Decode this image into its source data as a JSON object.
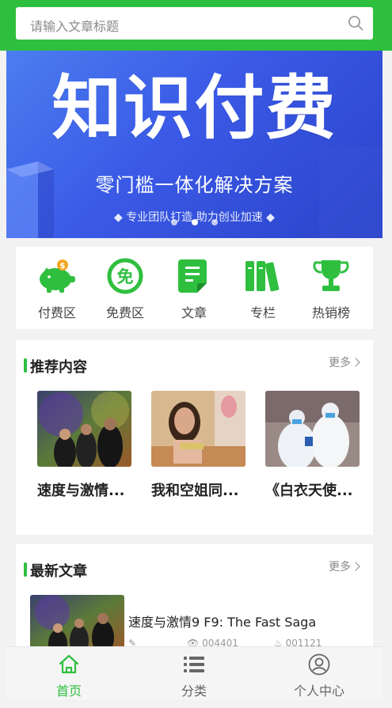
{
  "colors": {
    "primary": "#2fbf3f",
    "banner": "#3a59e6"
  },
  "search": {
    "placeholder": "请输入文章标题",
    "icon": "search-icon"
  },
  "banner": {
    "title": "知识付费",
    "subtitle": "零门槛一体化解决方案",
    "tagline": "◆ 专业团队打造 助力创业加速 ◆",
    "active_dot": 1,
    "dots": 3
  },
  "quick_links": [
    {
      "label": "付费区",
      "icon": "piggy-bank-icon"
    },
    {
      "label": "免费区",
      "icon": "free-badge-icon"
    },
    {
      "label": "文章",
      "icon": "document-icon"
    },
    {
      "label": "专栏",
      "icon": "books-icon"
    },
    {
      "label": "热销榜",
      "icon": "trophy-icon"
    }
  ],
  "recommended": {
    "title": "推荐内容",
    "more": "更多",
    "items": [
      {
        "name": "速度与激情..."
      },
      {
        "name": "我和空姐同..."
      },
      {
        "name": "《白衣天使..."
      }
    ]
  },
  "latest": {
    "title": "最新文章",
    "more": "更多",
    "items": [
      {
        "title": "速度与激情9 F9: The Fast Saga",
        "views": "004401",
        "likes": "001121"
      }
    ]
  },
  "tabs": [
    {
      "label": "首页",
      "icon": "home-icon",
      "active": true
    },
    {
      "label": "分类",
      "icon": "list-icon",
      "active": false
    },
    {
      "label": "个人中心",
      "icon": "user-icon",
      "active": false
    }
  ]
}
